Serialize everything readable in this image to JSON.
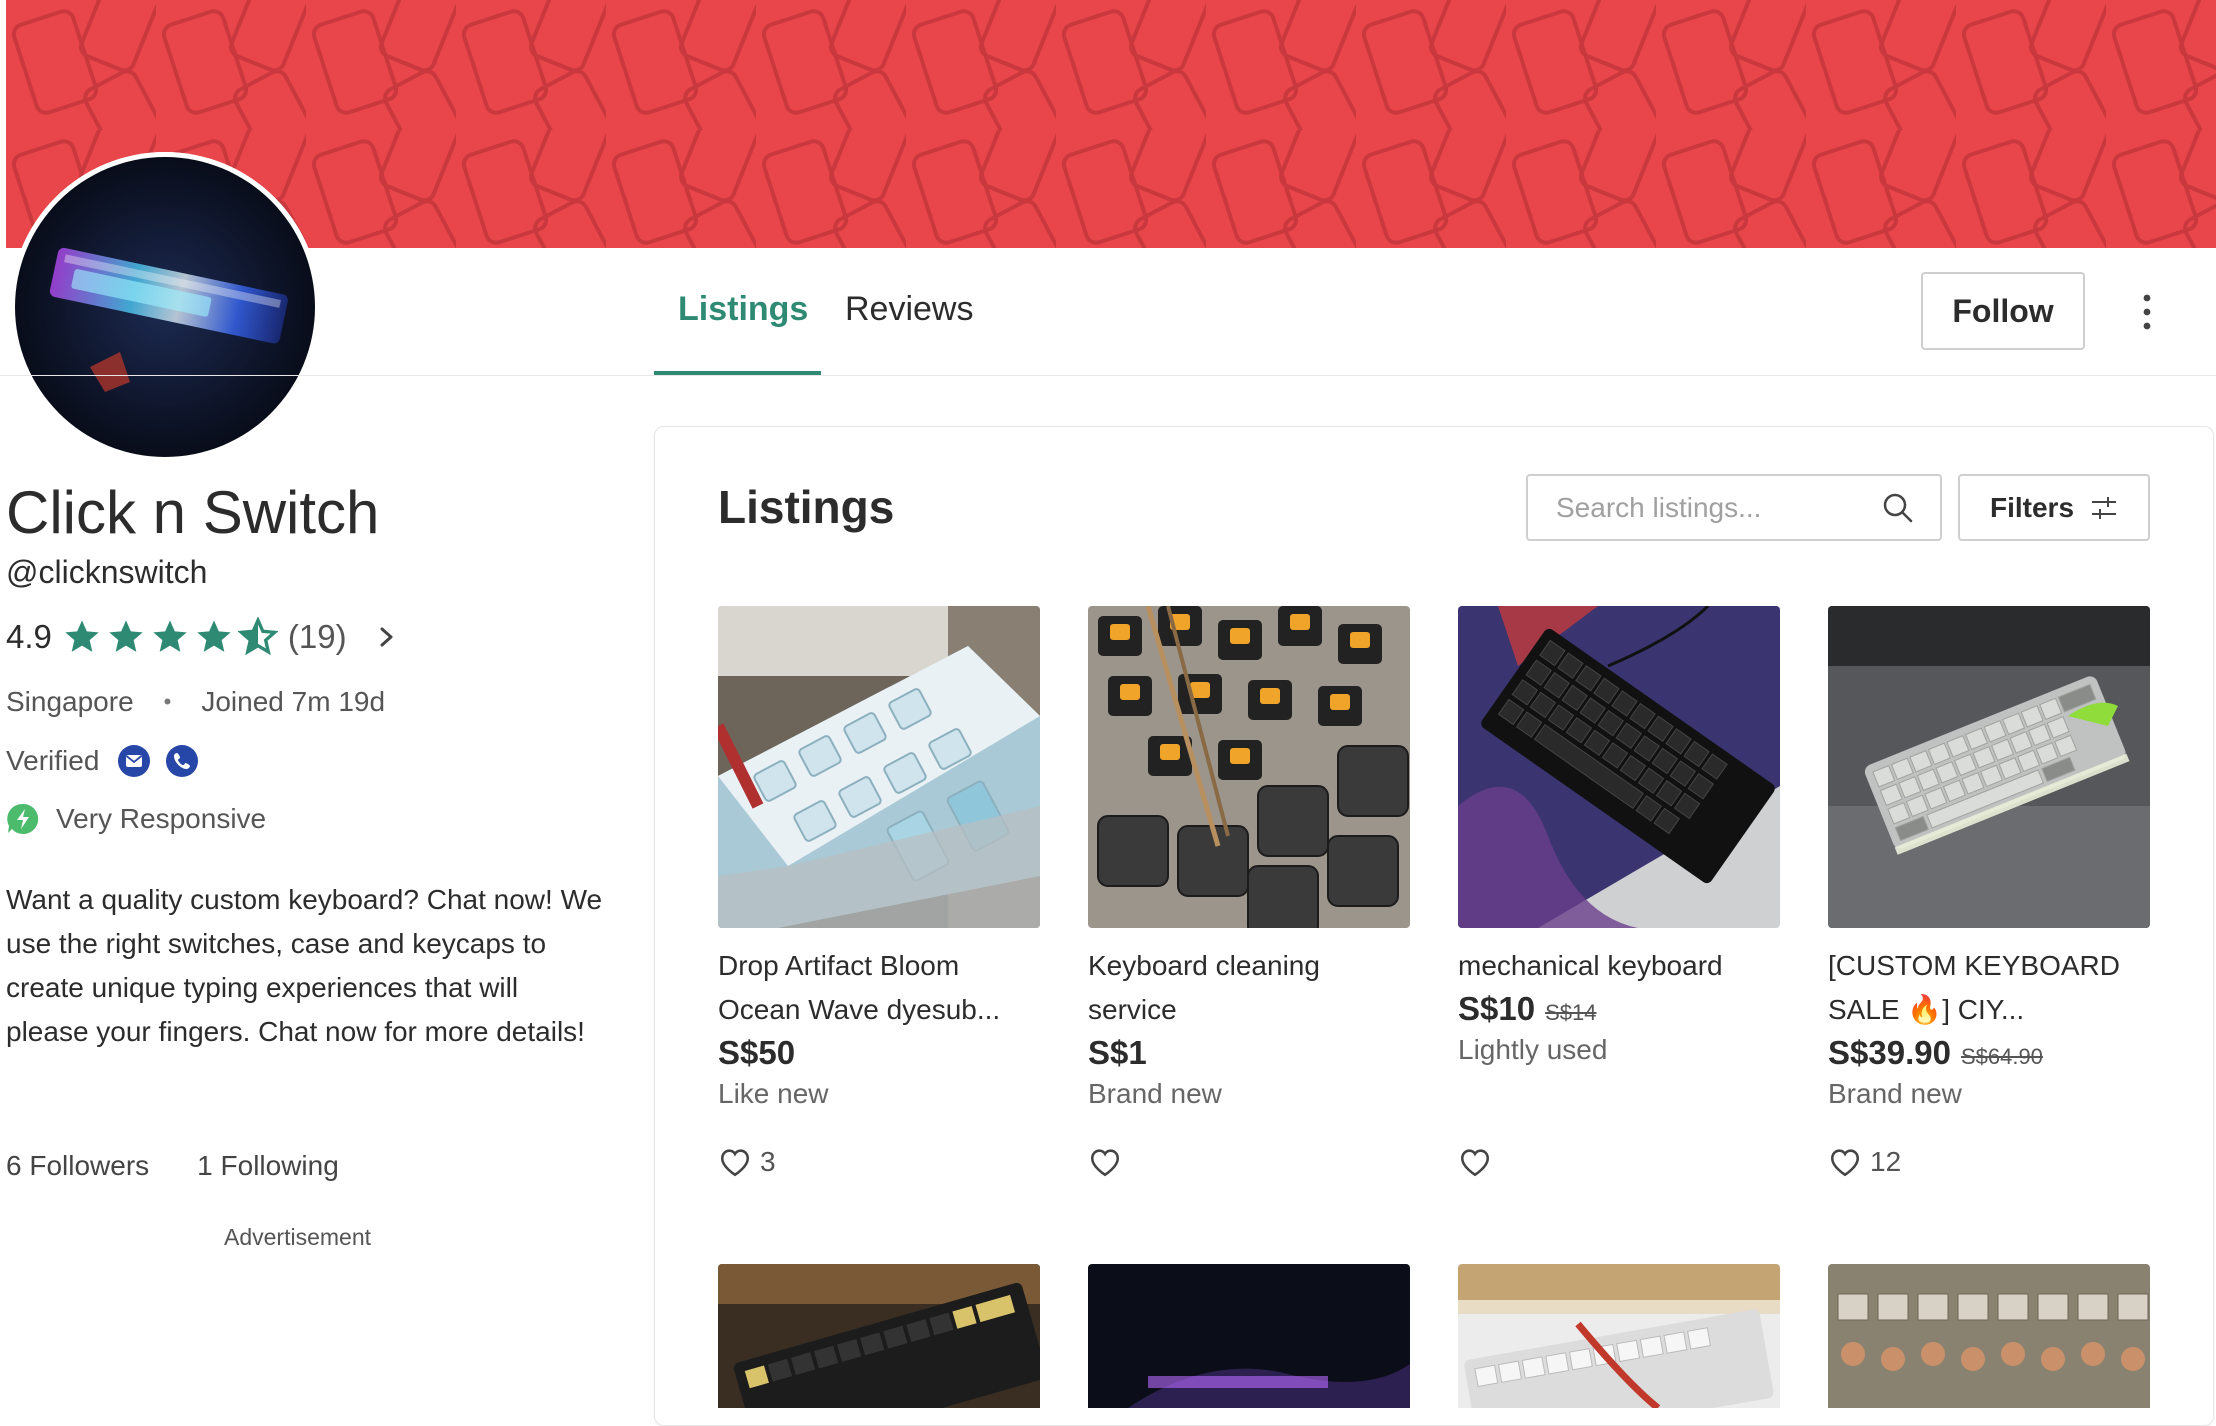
{
  "colors": {
    "accent": "#2f8a74",
    "banner": "#e8464a",
    "verified": "#2747a8",
    "responsive": "#4cbb6c"
  },
  "tabs": [
    {
      "label": "Listings",
      "active": true
    },
    {
      "label": "Reviews",
      "active": false
    }
  ],
  "header": {
    "follow_label": "Follow",
    "more_icon": "more-vertical-icon"
  },
  "profile": {
    "name": "Click n Switch",
    "handle": "@clicknswitch",
    "rating": "4.9",
    "stars": 4.5,
    "review_count": "(19)",
    "location": "Singapore",
    "separator": "•",
    "joined": "Joined 7m 19d",
    "verified_label": "Verified",
    "verified_icons": [
      "email-verified-icon",
      "phone-verified-icon"
    ],
    "responsiveness": "Very Responsive",
    "bio": "Want a quality custom keyboard? Chat now! We use the right switches, case and keycaps to create unique typing experiences that will please your fingers. Chat now for more details!",
    "followers": "6 Followers",
    "following": "1 Following",
    "advertisement_label": "Advertisement"
  },
  "listings": {
    "title": "Listings",
    "search_placeholder": "Search listings...",
    "filters_label": "Filters",
    "items": [
      {
        "title": "Drop Artifact Bloom Ocean Wave dyesub...",
        "price": "S$50",
        "old_price": "",
        "condition": "Like new",
        "likes": "3"
      },
      {
        "title": "Keyboard cleaning service",
        "price": "S$1",
        "old_price": "",
        "condition": "Brand new",
        "likes": ""
      },
      {
        "title": "mechanical keyboard",
        "price": "S$10",
        "old_price": "S$14",
        "condition": "Lightly used",
        "likes": ""
      },
      {
        "title": "[CUSTOM KEYBOARD SALE 🔥] CIY...",
        "price": "S$39.90",
        "old_price": "S$64.90",
        "condition": "Brand new",
        "likes": "12"
      }
    ]
  }
}
